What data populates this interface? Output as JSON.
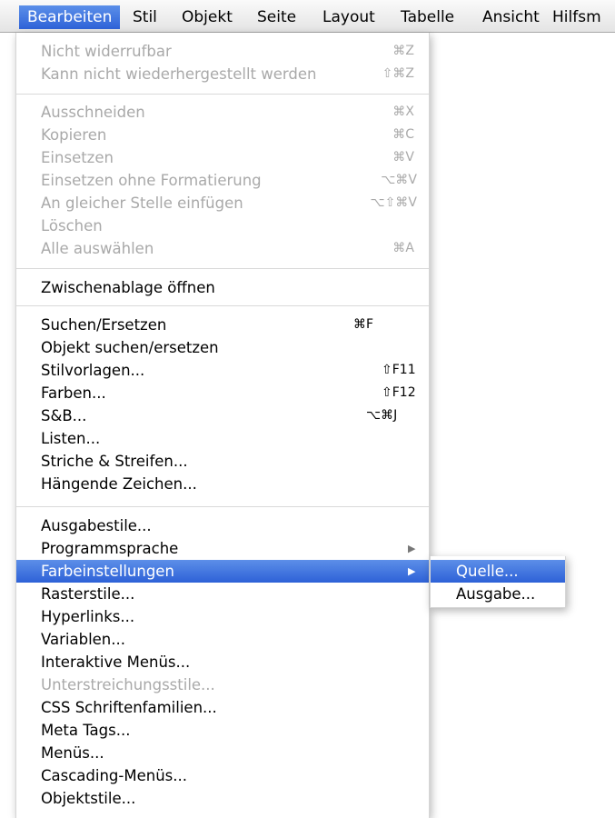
{
  "menubar": {
    "items": [
      "Bearbeiten",
      "Stil",
      "Objekt",
      "Seite",
      "Layout",
      "Tabelle",
      "Ansicht",
      "Hilfsm"
    ]
  },
  "menu": {
    "group1": [
      {
        "label": "Nicht widerrufbar",
        "shortcut": "⌘Z"
      },
      {
        "label": "Kann nicht wiederhergestellt werden",
        "shortcut": "⇧⌘Z"
      }
    ],
    "group2": [
      {
        "label": "Ausschneiden",
        "shortcut": "⌘X"
      },
      {
        "label": "Kopieren",
        "shortcut": "⌘C"
      },
      {
        "label": "Einsetzen",
        "shortcut": "⌘V"
      },
      {
        "label": "Einsetzen ohne Formatierung",
        "shortcut": "⌥⌘V"
      },
      {
        "label": "An gleicher Stelle einfügen",
        "shortcut": "⌥⇧⌘V"
      },
      {
        "label": "Löschen",
        "shortcut": ""
      },
      {
        "label": "Alle auswählen",
        "shortcut": "⌘A"
      }
    ],
    "group3": [
      {
        "label": "Zwischenablage öffnen",
        "shortcut": ""
      }
    ],
    "group4": [
      {
        "label": "Suchen/Ersetzen",
        "shortcut": "⌘F"
      },
      {
        "label": "Objekt suchen/ersetzen",
        "shortcut": ""
      },
      {
        "label": "Stilvorlagen...",
        "shortcut": "⇧F11"
      },
      {
        "label": "Farben...",
        "shortcut": "⇧F12"
      },
      {
        "label": "S&B...",
        "shortcut": "⌥⌘J"
      },
      {
        "label": "Listen...",
        "shortcut": ""
      },
      {
        "label": "Striche & Streifen...",
        "shortcut": ""
      },
      {
        "label": "Hängende Zeichen...",
        "shortcut": ""
      }
    ],
    "group5": [
      {
        "label": "Ausgabestile...",
        "shortcut": ""
      },
      {
        "label": "Programmsprache",
        "shortcut": "▶"
      },
      {
        "label": "Farbeinstellungen",
        "shortcut": "▶"
      },
      {
        "label": "Rasterstile...",
        "shortcut": ""
      },
      {
        "label": "Hyperlinks...",
        "shortcut": ""
      },
      {
        "label": "Variablen...",
        "shortcut": ""
      },
      {
        "label": "Interaktive Menüs...",
        "shortcut": ""
      },
      {
        "label": "Unterstreichungsstile...",
        "shortcut": ""
      },
      {
        "label": "CSS Schriftenfamilien...",
        "shortcut": ""
      },
      {
        "label": "Meta Tags...",
        "shortcut": ""
      },
      {
        "label": "Menüs...",
        "shortcut": ""
      },
      {
        "label": "Cascading-Menüs...",
        "shortcut": ""
      },
      {
        "label": "Objektstile...",
        "shortcut": ""
      }
    ]
  },
  "submenu": {
    "items": [
      {
        "label": "Quelle..."
      },
      {
        "label": "Ausgabe..."
      }
    ]
  }
}
